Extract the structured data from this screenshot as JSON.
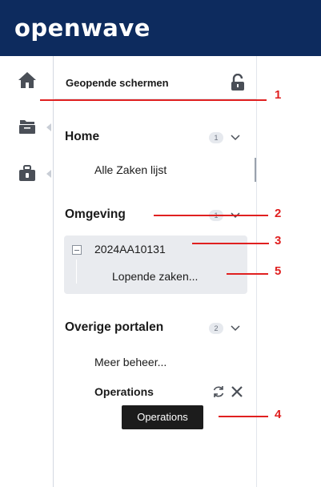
{
  "app": {
    "logo": "openwave"
  },
  "panel": {
    "title": "Geopende schermen",
    "sections": [
      {
        "label": "Home",
        "count": "1",
        "items": [
          "Alle Zaken lijst"
        ]
      },
      {
        "label": "Omgeving",
        "count": "1",
        "case_number": "2024AA10131",
        "case_sub": "Lopende zaken..."
      },
      {
        "label": "Overige portalen",
        "count": "2",
        "items": [
          "Meer beheer...",
          "Operations"
        ]
      }
    ],
    "tooltip": "Operations"
  },
  "rail": {
    "icons": [
      "home-icon",
      "folder-icon",
      "briefcase-icon"
    ]
  },
  "annotations": [
    "1",
    "2",
    "3",
    "4",
    "5"
  ],
  "colors": {
    "header": "#0d2b5e",
    "annotation": "#e02020",
    "card": "#e9ebef"
  }
}
